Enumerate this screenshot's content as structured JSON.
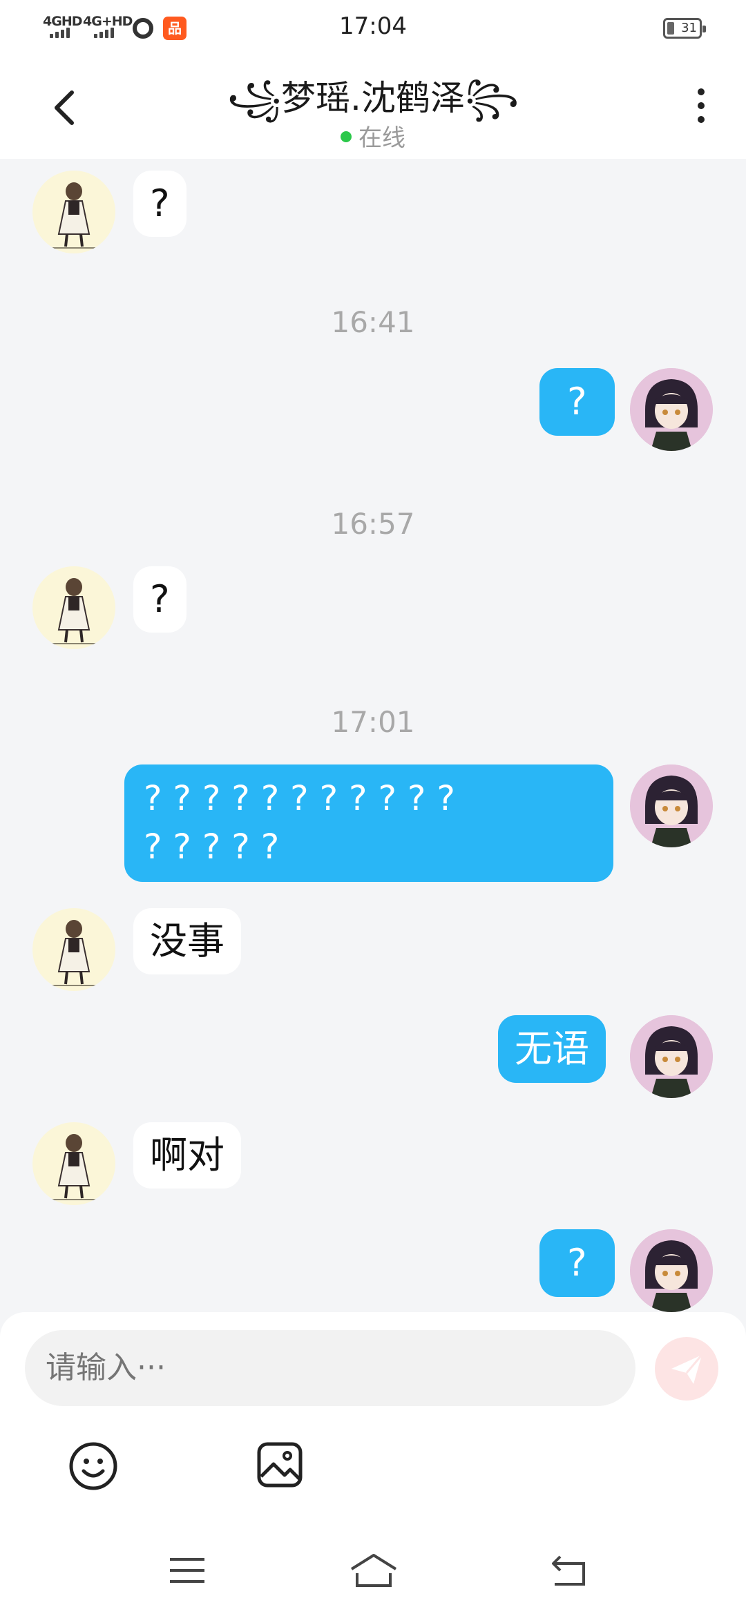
{
  "status_bar": {
    "network1": "4GHD",
    "network2": "4G+HD",
    "time": "17:04",
    "battery": "31",
    "app_icon_text": "品"
  },
  "header": {
    "title": "꧁梦瑶.沈鹤泽꧂",
    "status": "在线",
    "status_color": "#2bc84a"
  },
  "messages": [
    {
      "sender": "other",
      "text": "?"
    },
    {
      "timestamp": "16:41"
    },
    {
      "sender": "me",
      "text": "?"
    },
    {
      "timestamp": "16:57"
    },
    {
      "sender": "other",
      "text": "?"
    },
    {
      "timestamp": "17:01"
    },
    {
      "sender": "me",
      "text": "? ? ? ? ? ? ? ? ? ? ?\n? ? ? ? ?"
    },
    {
      "sender": "other",
      "text": "没事"
    },
    {
      "sender": "me",
      "text": "无语"
    },
    {
      "sender": "other",
      "text": "啊对"
    },
    {
      "sender": "me",
      "text": "?"
    }
  ],
  "input": {
    "placeholder": "请输入···"
  },
  "colors": {
    "my_bubble": "#29b6f6",
    "other_bubble": "#ffffff",
    "background": "#f4f5f7",
    "send_button": "#fde4e4"
  },
  "icons": {
    "back": "chevron-left-icon",
    "more": "more-vertical-icon",
    "send": "paper-plane-icon",
    "emoji": "smiley-icon",
    "image": "image-icon",
    "nav_menu": "menu-icon",
    "nav_home": "home-icon",
    "nav_back": "back-icon"
  }
}
